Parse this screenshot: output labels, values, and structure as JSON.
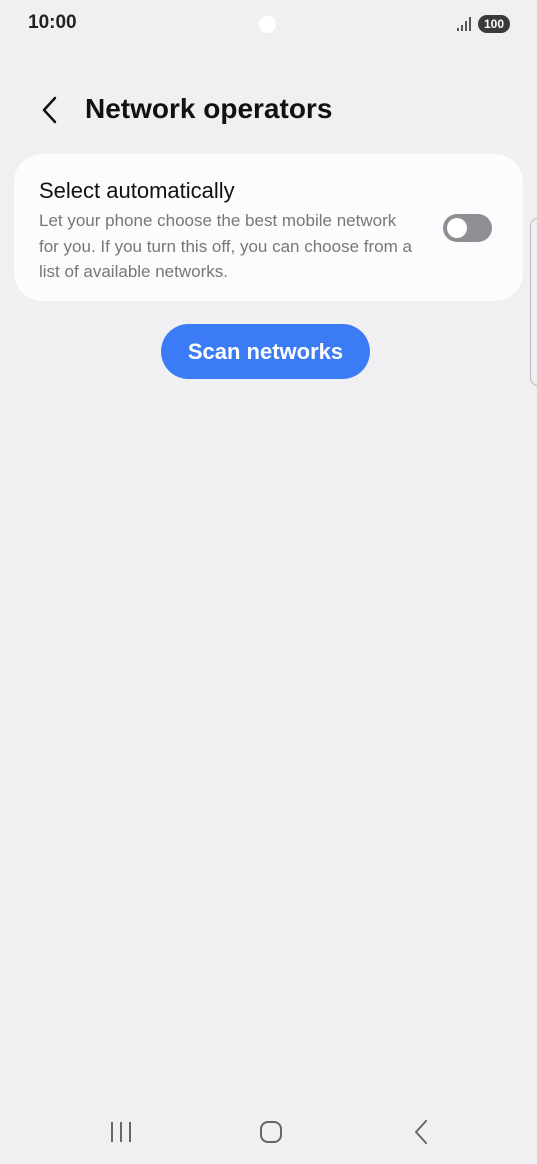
{
  "status_bar": {
    "time": "10:00",
    "battery": "100",
    "icons": [
      "signal-icon",
      "battery-icon"
    ]
  },
  "header": {
    "title": "Network operators",
    "back_icon": "chevron-left-icon"
  },
  "select_automatically": {
    "title": "Select automatically",
    "description": "Let your phone choose the best mobile network for you. If you turn this off, you can choose from a list of available networks.",
    "toggle_state": "off"
  },
  "actions": {
    "scan_label": "Scan networks"
  },
  "colors": {
    "background": "#f0f0f2",
    "card": "#fcfcfe",
    "accent": "#3b7bf6",
    "toggle_off": "#8e8e93"
  },
  "nav_bar": {
    "icons": [
      "recents-icon",
      "home-icon",
      "back-icon"
    ]
  }
}
